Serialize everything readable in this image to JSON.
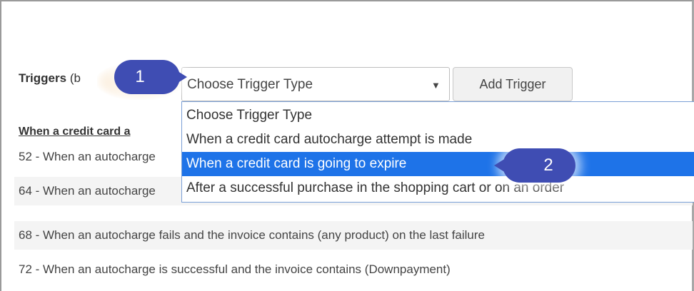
{
  "triggers": {
    "label": "Triggers",
    "label_paren": "(b"
  },
  "trigger_select": {
    "selected": "Choose Trigger Type",
    "caret": "▼",
    "options": [
      "Choose Trigger Type",
      "When a credit card autocharge attempt is made",
      "When a credit card is going to expire",
      "After a successful purchase in the shopping cart or on an order"
    ],
    "highlighted_index": 2
  },
  "add_trigger_button": {
    "label": "Add Trigger"
  },
  "section_heading": "When a credit card a",
  "rows": [
    "52 - When an autocharge",
    "64 - When an autocharge",
    "68 - When an autocharge fails and the invoice contains (any product) on the last failure",
    "72 - When an autocharge is successful and the invoice contains (Downpayment)"
  ],
  "callouts": [
    "1",
    "2"
  ],
  "colors": {
    "callout": "#3f4db3",
    "highlight": "#1e73e8",
    "dropdown_border": "#7a9fd6"
  }
}
